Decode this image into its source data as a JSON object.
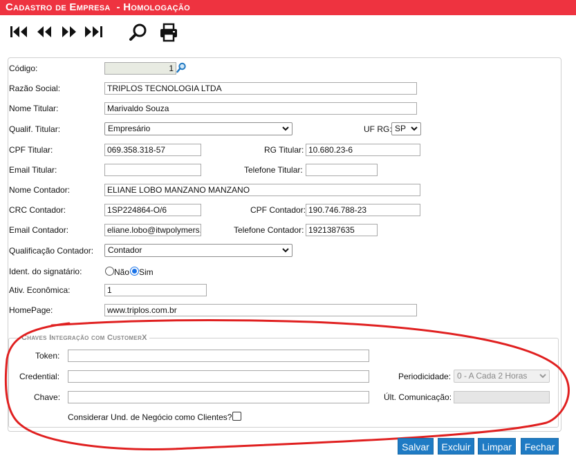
{
  "title": "Cadastro de Empresa  - Homologação",
  "toolbar": {
    "icons": [
      "first-icon",
      "prev-icon",
      "next-icon",
      "last-icon",
      "search-icon",
      "print-icon"
    ]
  },
  "form": {
    "codigo": {
      "label": "Código:",
      "value": "1"
    },
    "razao_social": {
      "label": "Razão Social:",
      "value": "TRIPLOS TECNOLOGIA LTDA"
    },
    "nome_titular": {
      "label": "Nome Titular:",
      "value": "Marivaldo Souza"
    },
    "qualif_titular": {
      "label": "Qualif. Titular:",
      "value": "Empresário"
    },
    "uf_rg": {
      "label": "UF RG:",
      "value": "SP"
    },
    "cpf_titular": {
      "label": "CPF Titular:",
      "value": "069.358.318-57"
    },
    "rg_titular": {
      "label": "RG Titular:",
      "value": "10.680.23-6"
    },
    "email_titular": {
      "label": "Email Titular:",
      "value": ""
    },
    "telefone_titular": {
      "label": "Telefone Titular:",
      "value": ""
    },
    "nome_contador": {
      "label": "Nome Contador:",
      "value": "ELIANE LOBO MANZANO MANZANO"
    },
    "crc_contador": {
      "label": "CRC Contador:",
      "value": "1SP224864-O/6"
    },
    "cpf_contador": {
      "label": "CPF Contador:",
      "value": "190.746.788-23"
    },
    "email_contador": {
      "label": "Email Contador:",
      "value": "eliane.lobo@itwpolymers."
    },
    "telefone_contador": {
      "label": "Telefone Contador:",
      "value": "1921387635"
    },
    "qualificacao_contador": {
      "label": "Qualificação Contador:",
      "value": "Contador"
    },
    "ident_signatario": {
      "label": "Ident. do signatário:",
      "option_nao": "Não",
      "option_sim": "Sim",
      "selected": "Sim"
    },
    "ativ_economica": {
      "label": "Ativ. Econômica:",
      "value": "1"
    },
    "homepage": {
      "label": "HomePage:",
      "value": "www.triplos.com.br"
    }
  },
  "integration": {
    "legend": "Chaves Integração com CustomerX",
    "token": {
      "label": "Token:",
      "value": ""
    },
    "credential": {
      "label": "Credential:",
      "value": ""
    },
    "chave": {
      "label": "Chave:",
      "value": ""
    },
    "periodicidade": {
      "label": "Periodicidade:",
      "value": "0 - A Cada 2 Horas"
    },
    "ult_comunicacao": {
      "label": "Últ. Comunicação:",
      "value": ""
    },
    "considerar": {
      "label": "Considerar Und. de Negócio como Clientes?",
      "checked": false
    }
  },
  "buttons": {
    "salvar": "Salvar",
    "excluir": "Excluir",
    "limpar": "Limpar",
    "fechar": "Fechar"
  },
  "colors": {
    "titlebar": "#ee3340",
    "button": "#1f7bc4",
    "annotation": "#e02020"
  }
}
